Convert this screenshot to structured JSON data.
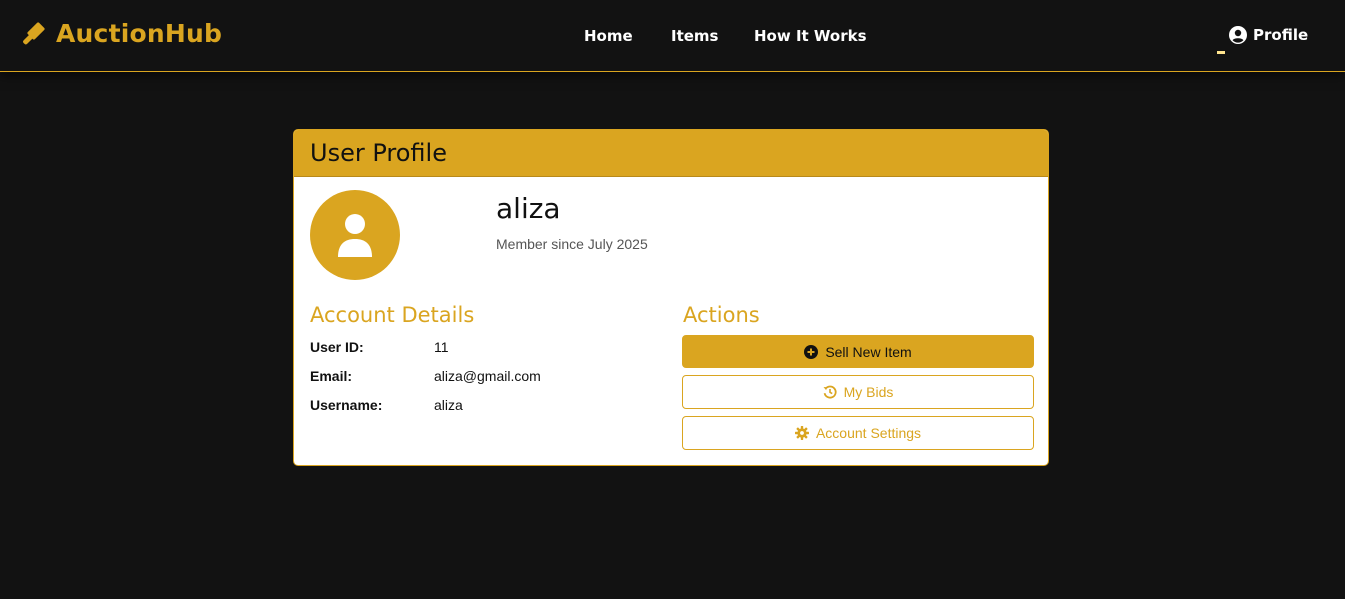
{
  "navbar": {
    "brand": "AuctionHub",
    "links": [
      "Home",
      "Items",
      "How It Works"
    ],
    "profile_label": "Profile"
  },
  "profile_card": {
    "title": "User Profile",
    "username": "aliza",
    "member_since": "Member since July 2025"
  },
  "account_details": {
    "title": "Account Details",
    "rows": [
      {
        "label": "User ID:",
        "value": "11"
      },
      {
        "label": "Email:",
        "value": "aliza@gmail.com"
      },
      {
        "label": "Username:",
        "value": "aliza"
      }
    ]
  },
  "actions": {
    "title": "Actions",
    "sell_label": "Sell New Item",
    "bids_label": "My Bids",
    "settings_label": "Account Settings"
  },
  "colors": {
    "accent": "#DAA520",
    "background": "#121212",
    "card_bg": "#FFFFFF"
  },
  "icons": {
    "brand": "gavel-icon",
    "profile": "user-circle-icon",
    "avatar": "user-icon",
    "sell": "plus-circle-icon",
    "bids": "history-icon",
    "settings": "gear-icon"
  }
}
